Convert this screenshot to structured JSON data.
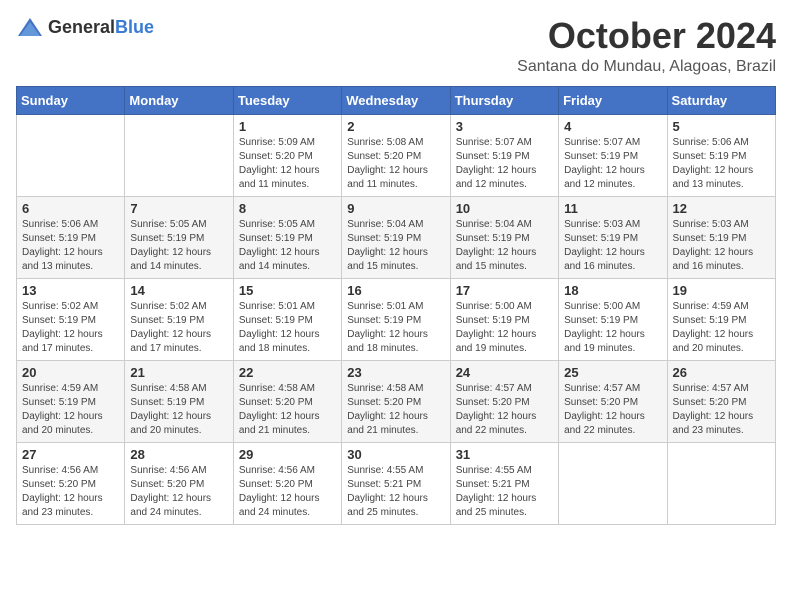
{
  "header": {
    "logo_general": "General",
    "logo_blue": "Blue",
    "month_title": "October 2024",
    "location": "Santana do Mundau, Alagoas, Brazil"
  },
  "weekdays": [
    "Sunday",
    "Monday",
    "Tuesday",
    "Wednesday",
    "Thursday",
    "Friday",
    "Saturday"
  ],
  "weeks": [
    [
      {
        "day": "",
        "info": ""
      },
      {
        "day": "",
        "info": ""
      },
      {
        "day": "1",
        "info": "Sunrise: 5:09 AM\nSunset: 5:20 PM\nDaylight: 12 hours\nand 11 minutes."
      },
      {
        "day": "2",
        "info": "Sunrise: 5:08 AM\nSunset: 5:20 PM\nDaylight: 12 hours\nand 11 minutes."
      },
      {
        "day": "3",
        "info": "Sunrise: 5:07 AM\nSunset: 5:19 PM\nDaylight: 12 hours\nand 12 minutes."
      },
      {
        "day": "4",
        "info": "Sunrise: 5:07 AM\nSunset: 5:19 PM\nDaylight: 12 hours\nand 12 minutes."
      },
      {
        "day": "5",
        "info": "Sunrise: 5:06 AM\nSunset: 5:19 PM\nDaylight: 12 hours\nand 13 minutes."
      }
    ],
    [
      {
        "day": "6",
        "info": "Sunrise: 5:06 AM\nSunset: 5:19 PM\nDaylight: 12 hours\nand 13 minutes."
      },
      {
        "day": "7",
        "info": "Sunrise: 5:05 AM\nSunset: 5:19 PM\nDaylight: 12 hours\nand 14 minutes."
      },
      {
        "day": "8",
        "info": "Sunrise: 5:05 AM\nSunset: 5:19 PM\nDaylight: 12 hours\nand 14 minutes."
      },
      {
        "day": "9",
        "info": "Sunrise: 5:04 AM\nSunset: 5:19 PM\nDaylight: 12 hours\nand 15 minutes."
      },
      {
        "day": "10",
        "info": "Sunrise: 5:04 AM\nSunset: 5:19 PM\nDaylight: 12 hours\nand 15 minutes."
      },
      {
        "day": "11",
        "info": "Sunrise: 5:03 AM\nSunset: 5:19 PM\nDaylight: 12 hours\nand 16 minutes."
      },
      {
        "day": "12",
        "info": "Sunrise: 5:03 AM\nSunset: 5:19 PM\nDaylight: 12 hours\nand 16 minutes."
      }
    ],
    [
      {
        "day": "13",
        "info": "Sunrise: 5:02 AM\nSunset: 5:19 PM\nDaylight: 12 hours\nand 17 minutes."
      },
      {
        "day": "14",
        "info": "Sunrise: 5:02 AM\nSunset: 5:19 PM\nDaylight: 12 hours\nand 17 minutes."
      },
      {
        "day": "15",
        "info": "Sunrise: 5:01 AM\nSunset: 5:19 PM\nDaylight: 12 hours\nand 18 minutes."
      },
      {
        "day": "16",
        "info": "Sunrise: 5:01 AM\nSunset: 5:19 PM\nDaylight: 12 hours\nand 18 minutes."
      },
      {
        "day": "17",
        "info": "Sunrise: 5:00 AM\nSunset: 5:19 PM\nDaylight: 12 hours\nand 19 minutes."
      },
      {
        "day": "18",
        "info": "Sunrise: 5:00 AM\nSunset: 5:19 PM\nDaylight: 12 hours\nand 19 minutes."
      },
      {
        "day": "19",
        "info": "Sunrise: 4:59 AM\nSunset: 5:19 PM\nDaylight: 12 hours\nand 20 minutes."
      }
    ],
    [
      {
        "day": "20",
        "info": "Sunrise: 4:59 AM\nSunset: 5:19 PM\nDaylight: 12 hours\nand 20 minutes."
      },
      {
        "day": "21",
        "info": "Sunrise: 4:58 AM\nSunset: 5:19 PM\nDaylight: 12 hours\nand 20 minutes."
      },
      {
        "day": "22",
        "info": "Sunrise: 4:58 AM\nSunset: 5:20 PM\nDaylight: 12 hours\nand 21 minutes."
      },
      {
        "day": "23",
        "info": "Sunrise: 4:58 AM\nSunset: 5:20 PM\nDaylight: 12 hours\nand 21 minutes."
      },
      {
        "day": "24",
        "info": "Sunrise: 4:57 AM\nSunset: 5:20 PM\nDaylight: 12 hours\nand 22 minutes."
      },
      {
        "day": "25",
        "info": "Sunrise: 4:57 AM\nSunset: 5:20 PM\nDaylight: 12 hours\nand 22 minutes."
      },
      {
        "day": "26",
        "info": "Sunrise: 4:57 AM\nSunset: 5:20 PM\nDaylight: 12 hours\nand 23 minutes."
      }
    ],
    [
      {
        "day": "27",
        "info": "Sunrise: 4:56 AM\nSunset: 5:20 PM\nDaylight: 12 hours\nand 23 minutes."
      },
      {
        "day": "28",
        "info": "Sunrise: 4:56 AM\nSunset: 5:20 PM\nDaylight: 12 hours\nand 24 minutes."
      },
      {
        "day": "29",
        "info": "Sunrise: 4:56 AM\nSunset: 5:20 PM\nDaylight: 12 hours\nand 24 minutes."
      },
      {
        "day": "30",
        "info": "Sunrise: 4:55 AM\nSunset: 5:21 PM\nDaylight: 12 hours\nand 25 minutes."
      },
      {
        "day": "31",
        "info": "Sunrise: 4:55 AM\nSunset: 5:21 PM\nDaylight: 12 hours\nand 25 minutes."
      },
      {
        "day": "",
        "info": ""
      },
      {
        "day": "",
        "info": ""
      }
    ]
  ]
}
